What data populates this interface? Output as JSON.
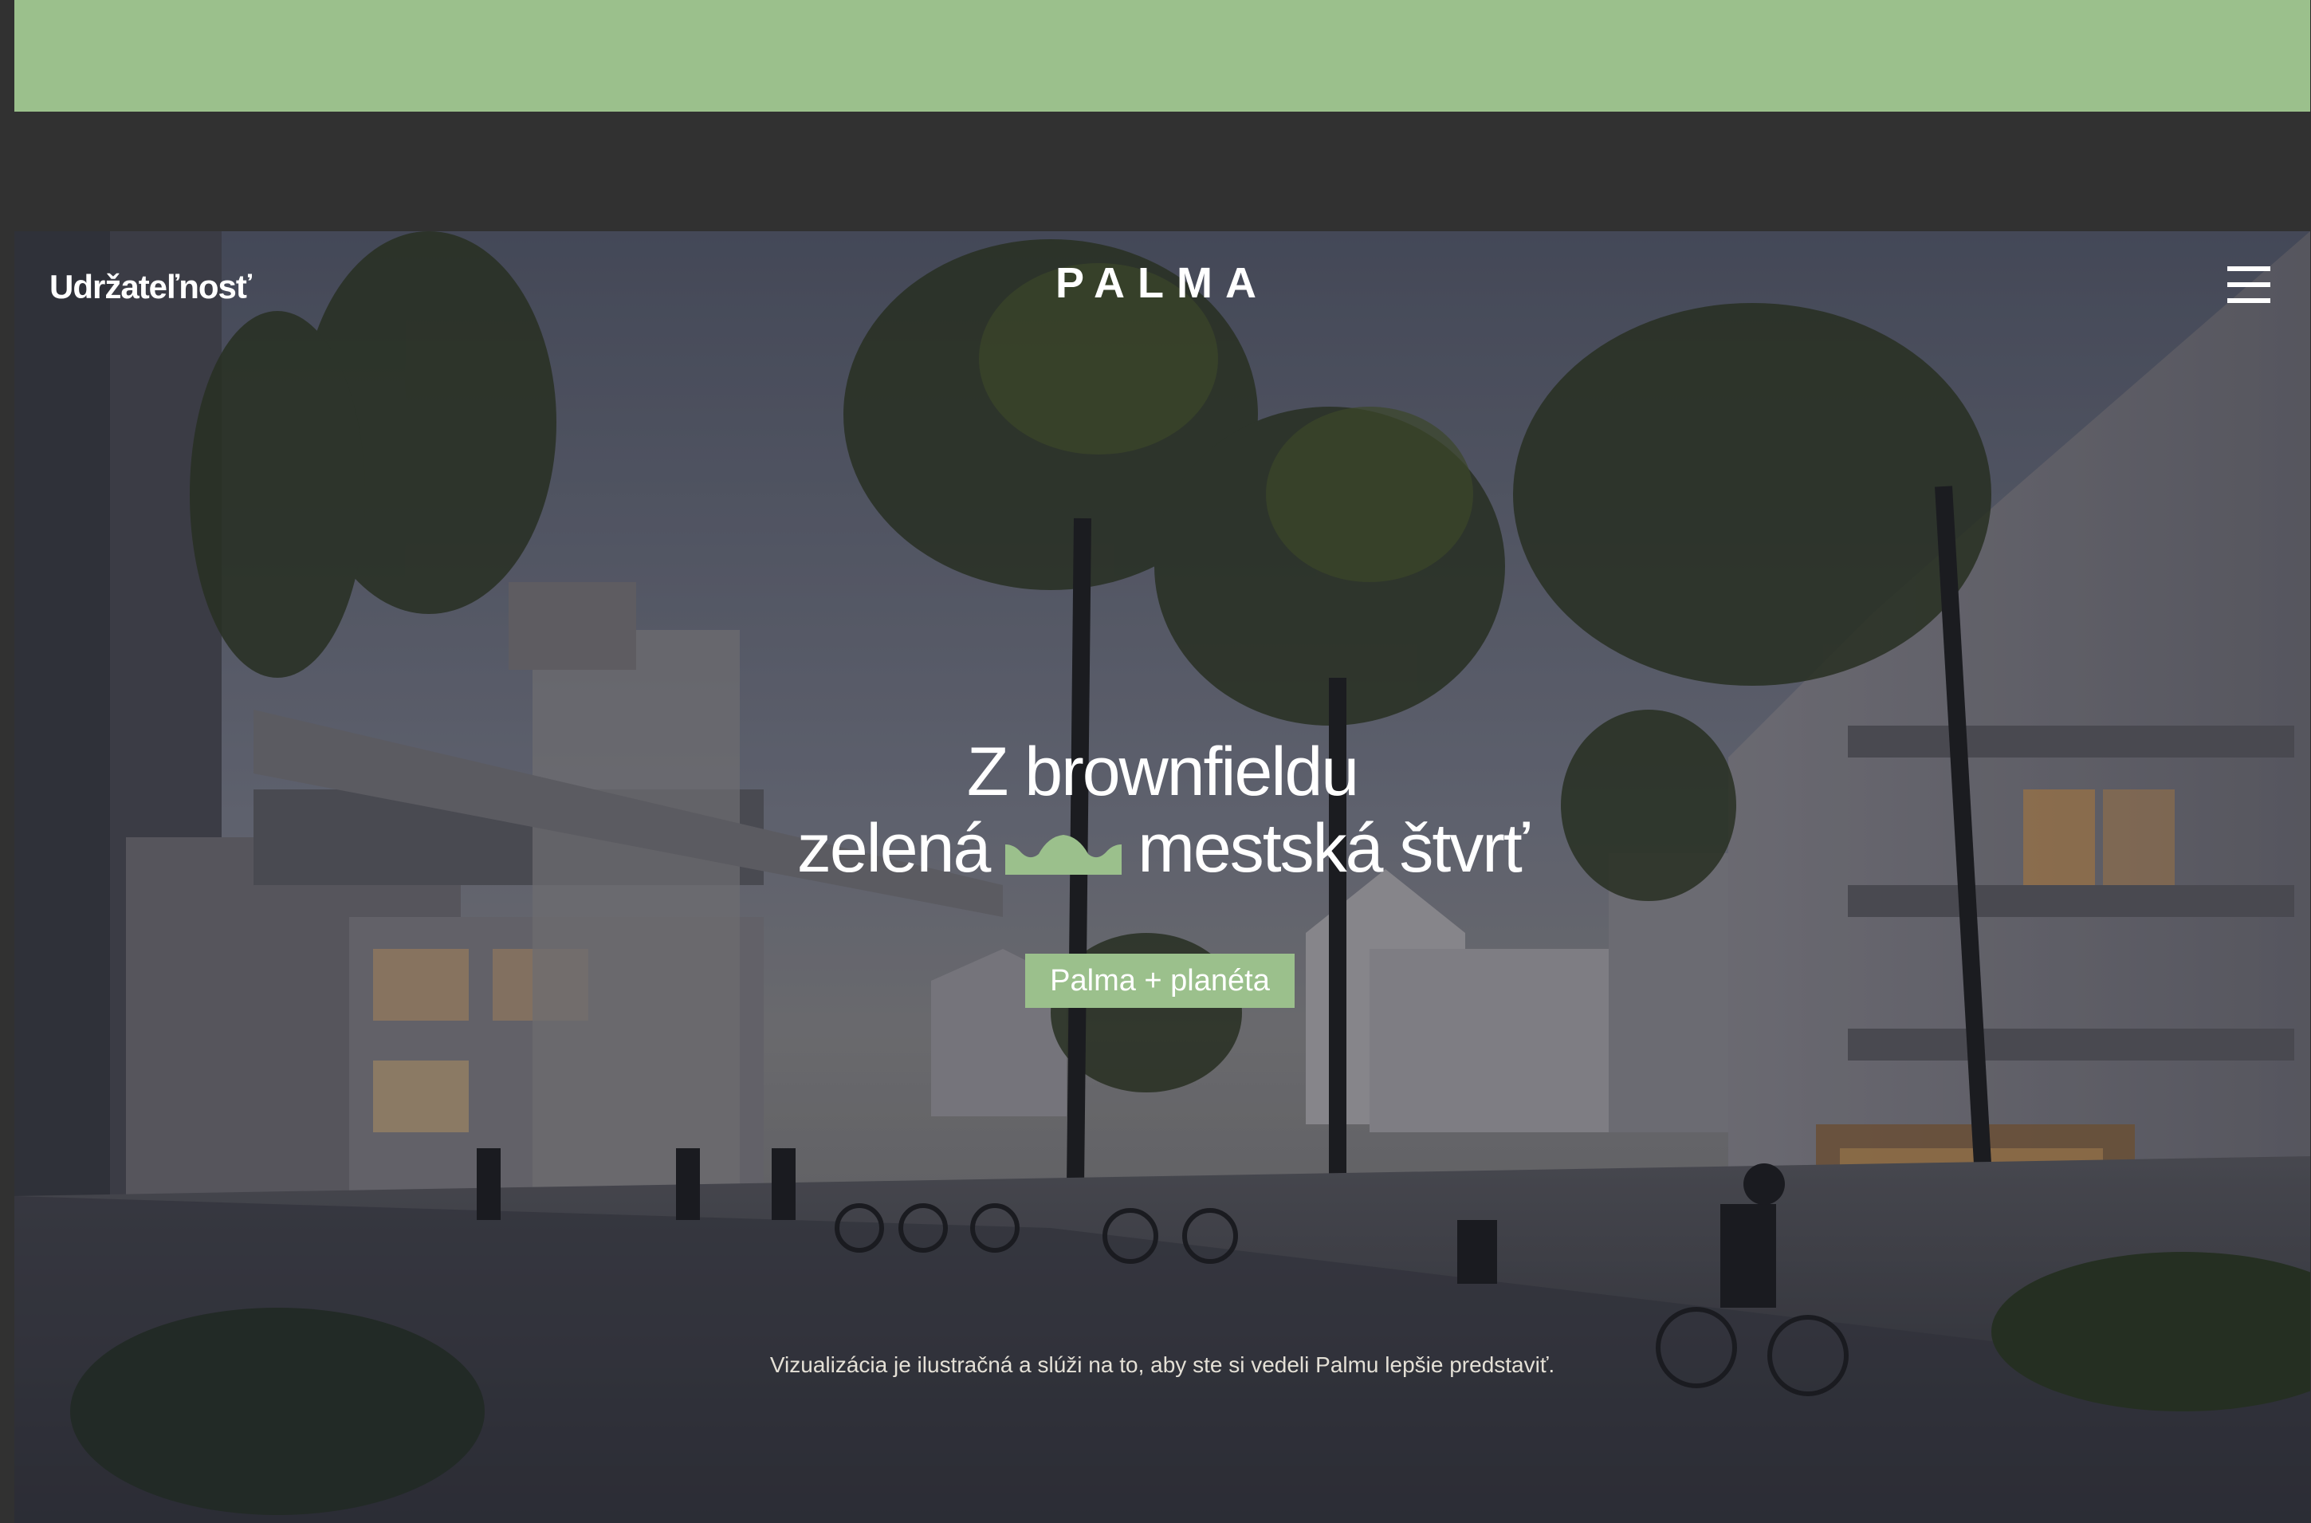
{
  "header": {
    "nav_link": "Udržateľnosť",
    "logo": "PALMA",
    "menu_icon": "hamburger-menu-icon"
  },
  "hero": {
    "headline_line1": "Z brownfieldu",
    "headline_line2_before": "zelená",
    "headline_icon": "green-hills-icon",
    "headline_line2_after": "mestská štvrť",
    "cta_label": "Palma + planéta",
    "disclaimer": "Vizualizácia je ilustračná a slúži na to, aby ste si vedeli Palmu lepšie predstaviť."
  },
  "colors": {
    "accent_green": "#9bc08c",
    "page_background": "#313131",
    "text_white": "#ffffff"
  }
}
